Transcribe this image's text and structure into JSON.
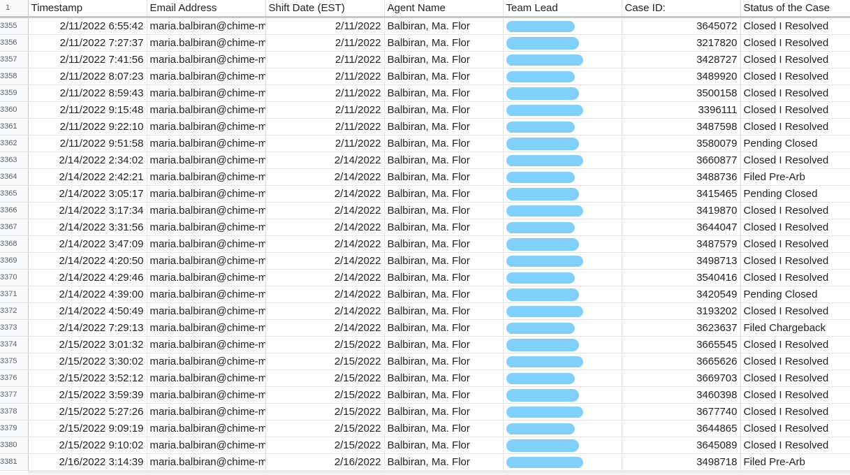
{
  "columns": {
    "row_header": "1",
    "timestamp": "Timestamp",
    "email": "Email Address",
    "shift_date": "Shift Date (EST)",
    "agent": "Agent Name",
    "team_lead": "Team Lead",
    "case_id": "Case ID:",
    "status": "Status of the Case"
  },
  "lead_redaction_color": "#7fd0fb",
  "rows": [
    {
      "num": "3355",
      "timestamp": "2/11/2022 6:55:42",
      "email": "maria.balbiran@chime-m",
      "shift_date": "2/11/2022",
      "agent": "Balbiran, Ma. Flor",
      "case_id": "3645072",
      "status": "Closed I Resolved"
    },
    {
      "num": "3356",
      "timestamp": "2/11/2022 7:27:37",
      "email": "maria.balbiran@chime-m",
      "shift_date": "2/11/2022",
      "agent": "Balbiran, Ma. Flor",
      "case_id": "3217820",
      "status": "Closed I Resolved"
    },
    {
      "num": "3357",
      "timestamp": "2/11/2022 7:41:56",
      "email": "maria.balbiran@chime-m",
      "shift_date": "2/11/2022",
      "agent": "Balbiran, Ma. Flor",
      "case_id": "3428727",
      "status": "Closed I Resolved"
    },
    {
      "num": "3358",
      "timestamp": "2/11/2022 8:07:23",
      "email": "maria.balbiran@chime-m",
      "shift_date": "2/11/2022",
      "agent": "Balbiran, Ma. Flor",
      "case_id": "3489920",
      "status": "Closed I Resolved"
    },
    {
      "num": "3359",
      "timestamp": "2/11/2022 8:59:43",
      "email": "maria.balbiran@chime-m",
      "shift_date": "2/11/2022",
      "agent": "Balbiran, Ma. Flor",
      "case_id": "3500158",
      "status": "Closed I Resolved"
    },
    {
      "num": "3360",
      "timestamp": "2/11/2022 9:15:48",
      "email": "maria.balbiran@chime-m",
      "shift_date": "2/11/2022",
      "agent": "Balbiran, Ma. Flor",
      "case_id": "3396111",
      "status": "Closed I Resolved"
    },
    {
      "num": "3361",
      "timestamp": "2/11/2022 9:22:10",
      "email": "maria.balbiran@chime-m",
      "shift_date": "2/11/2022",
      "agent": "Balbiran, Ma. Flor",
      "case_id": "3487598",
      "status": "Closed I Resolved"
    },
    {
      "num": "3362",
      "timestamp": "2/11/2022 9:51:58",
      "email": "maria.balbiran@chime-m",
      "shift_date": "2/11/2022",
      "agent": "Balbiran, Ma. Flor",
      "case_id": "3580079",
      "status": "Pending Closed"
    },
    {
      "num": "3363",
      "timestamp": "2/14/2022 2:34:02",
      "email": "maria.balbiran@chime-m",
      "shift_date": "2/14/2022",
      "agent": "Balbiran, Ma. Flor",
      "case_id": "3660877",
      "status": "Closed I Resolved"
    },
    {
      "num": "3364",
      "timestamp": "2/14/2022 2:42:21",
      "email": "maria.balbiran@chime-m",
      "shift_date": "2/14/2022",
      "agent": "Balbiran, Ma. Flor",
      "case_id": "3488736",
      "status": "Filed Pre-Arb"
    },
    {
      "num": "3365",
      "timestamp": "2/14/2022 3:05:17",
      "email": "maria.balbiran@chime-m",
      "shift_date": "2/14/2022",
      "agent": "Balbiran, Ma. Flor",
      "case_id": "3415465",
      "status": "Pending Closed"
    },
    {
      "num": "3366",
      "timestamp": "2/14/2022 3:17:34",
      "email": "maria.balbiran@chime-m",
      "shift_date": "2/14/2022",
      "agent": "Balbiran, Ma. Flor",
      "case_id": "3419870",
      "status": "Closed I Resolved"
    },
    {
      "num": "3367",
      "timestamp": "2/14/2022 3:31:56",
      "email": "maria.balbiran@chime-m",
      "shift_date": "2/14/2022",
      "agent": "Balbiran, Ma. Flor",
      "case_id": "3644047",
      "status": "Closed I Resolved"
    },
    {
      "num": "3368",
      "timestamp": "2/14/2022 3:47:09",
      "email": "maria.balbiran@chime-m",
      "shift_date": "2/14/2022",
      "agent": "Balbiran, Ma. Flor",
      "case_id": "3487579",
      "status": "Closed I Resolved"
    },
    {
      "num": "3369",
      "timestamp": "2/14/2022 4:20:50",
      "email": "maria.balbiran@chime-m",
      "shift_date": "2/14/2022",
      "agent": "Balbiran, Ma. Flor",
      "case_id": "3498713",
      "status": "Closed I Resolved"
    },
    {
      "num": "3370",
      "timestamp": "2/14/2022 4:29:46",
      "email": "maria.balbiran@chime-m",
      "shift_date": "2/14/2022",
      "agent": "Balbiran, Ma. Flor",
      "case_id": "3540416",
      "status": "Closed I Resolved"
    },
    {
      "num": "3371",
      "timestamp": "2/14/2022 4:39:00",
      "email": "maria.balbiran@chime-m",
      "shift_date": "2/14/2022",
      "agent": "Balbiran, Ma. Flor",
      "case_id": "3420549",
      "status": "Pending Closed"
    },
    {
      "num": "3372",
      "timestamp": "2/14/2022 4:50:49",
      "email": "maria.balbiran@chime-m",
      "shift_date": "2/14/2022",
      "agent": "Balbiran, Ma. Flor",
      "case_id": "3193202",
      "status": "Closed I Resolved"
    },
    {
      "num": "3373",
      "timestamp": "2/14/2022 7:29:13",
      "email": "maria.balbiran@chime-m",
      "shift_date": "2/14/2022",
      "agent": "Balbiran, Ma. Flor",
      "case_id": "3623637",
      "status": "Filed Chargeback"
    },
    {
      "num": "3374",
      "timestamp": "2/15/2022 3:01:32",
      "email": "maria.balbiran@chime-m",
      "shift_date": "2/15/2022",
      "agent": "Balbiran, Ma. Flor",
      "case_id": "3665545",
      "status": "Closed I Resolved"
    },
    {
      "num": "3375",
      "timestamp": "2/15/2022 3:30:02",
      "email": "maria.balbiran@chime-m",
      "shift_date": "2/15/2022",
      "agent": "Balbiran, Ma. Flor",
      "case_id": "3665626",
      "status": "Closed I Resolved"
    },
    {
      "num": "3376",
      "timestamp": "2/15/2022 3:52:12",
      "email": "maria.balbiran@chime-m",
      "shift_date": "2/15/2022",
      "agent": "Balbiran, Ma. Flor",
      "case_id": "3669703",
      "status": "Closed I Resolved"
    },
    {
      "num": "3377",
      "timestamp": "2/15/2022 3:59:39",
      "email": "maria.balbiran@chime-m",
      "shift_date": "2/15/2022",
      "agent": "Balbiran, Ma. Flor",
      "case_id": "3460398",
      "status": "Closed I Resolved"
    },
    {
      "num": "3378",
      "timestamp": "2/15/2022 5:27:26",
      "email": "maria.balbiran@chime-m",
      "shift_date": "2/15/2022",
      "agent": "Balbiran, Ma. Flor",
      "case_id": "3677740",
      "status": "Closed I Resolved"
    },
    {
      "num": "3379",
      "timestamp": "2/15/2022 9:09:19",
      "email": "maria.balbiran@chime-m",
      "shift_date": "2/15/2022",
      "agent": "Balbiran, Ma. Flor",
      "case_id": "3644865",
      "status": "Closed I Resolved"
    },
    {
      "num": "3380",
      "timestamp": "2/15/2022 9:10:02",
      "email": "maria.balbiran@chime-m",
      "shift_date": "2/15/2022",
      "agent": "Balbiran, Ma. Flor",
      "case_id": "3645089",
      "status": "Closed I Resolved"
    },
    {
      "num": "3381",
      "timestamp": "2/16/2022 3:14:39",
      "email": "maria.balbiran@chime-m",
      "shift_date": "2/16/2022",
      "agent": "Balbiran, Ma. Flor",
      "case_id": "3498718",
      "status": "Filed Pre-Arb"
    }
  ]
}
